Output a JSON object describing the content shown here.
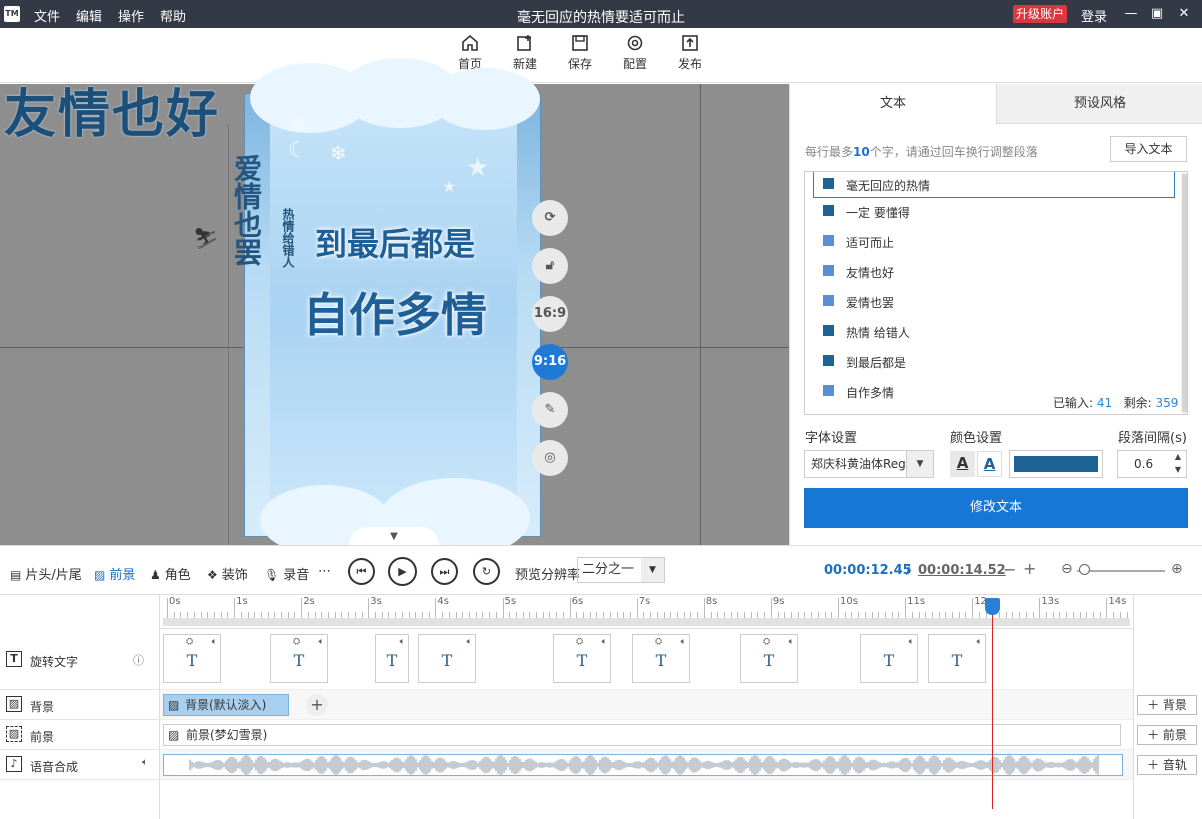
{
  "app": {
    "logo": "TM",
    "title": "毫无回应的热情要适可而止"
  },
  "menu": [
    "文件",
    "编辑",
    "操作",
    "帮助"
  ],
  "titlebar": {
    "upgrade": "升级账户",
    "login": "登录"
  },
  "toolbar": {
    "home": "首页",
    "new": "新建",
    "save": "保存",
    "config": "配置",
    "publish": "发布"
  },
  "preview": {
    "background_text": "友情也好",
    "vertical_text": "爱情也罢",
    "vertical_small": "热情给错人",
    "line1": "到最后都是",
    "line2": "自作多情",
    "ratio_16_9": "16:9",
    "ratio_9_16": "9:16"
  },
  "panel": {
    "tabs": [
      "文本",
      "预设风格"
    ],
    "hint_prefix": "每行最多",
    "hint_num": "10",
    "hint_suffix": "个字，请通过回车换行调整段落",
    "import_button": "导入文本",
    "lines": [
      "毫无回应的热情",
      "一定  要懂得",
      "适可而止",
      "友情也好",
      "爱情也罢",
      "热情  给错人",
      "到最后都是",
      "自作多情"
    ],
    "entered_label": "已输入:",
    "entered": "41",
    "remaining_label": "剩余:",
    "remaining": "359",
    "font_label": "字体设置",
    "color_label": "颜色设置",
    "spacing_label": "段落间隔(s)",
    "font_value": "郑庆科黄油体Regular",
    "spacing_value": "0.6",
    "modify_button": "修改文本",
    "text_color": "#1d6395"
  },
  "controls": {
    "opening": "片头/片尾",
    "foreground": "前景",
    "role": "角色",
    "decor": "装饰",
    "record": "录音",
    "res_label": "预览分辨率",
    "res_value": "二分之一",
    "time_current": "00:00:12.45",
    "time_sep": "/",
    "time_total": "00:00:14.52"
  },
  "timeline": {
    "ticks": [
      "0s",
      "1s",
      "2s",
      "3s",
      "4s",
      "5s",
      "6s",
      "7s",
      "8s",
      "9s",
      "10s",
      "11s",
      "12s",
      "13s",
      "14s"
    ],
    "tracks": [
      "旋转文字",
      "背景",
      "前景",
      "语音合成"
    ],
    "bg_clip": "背景(默认淡入)",
    "fg_clip": "前景(梦幻雪景)",
    "add_bg": "背景",
    "add_fg": "前景",
    "add_audio": "音轨",
    "clip_letter": "T"
  }
}
